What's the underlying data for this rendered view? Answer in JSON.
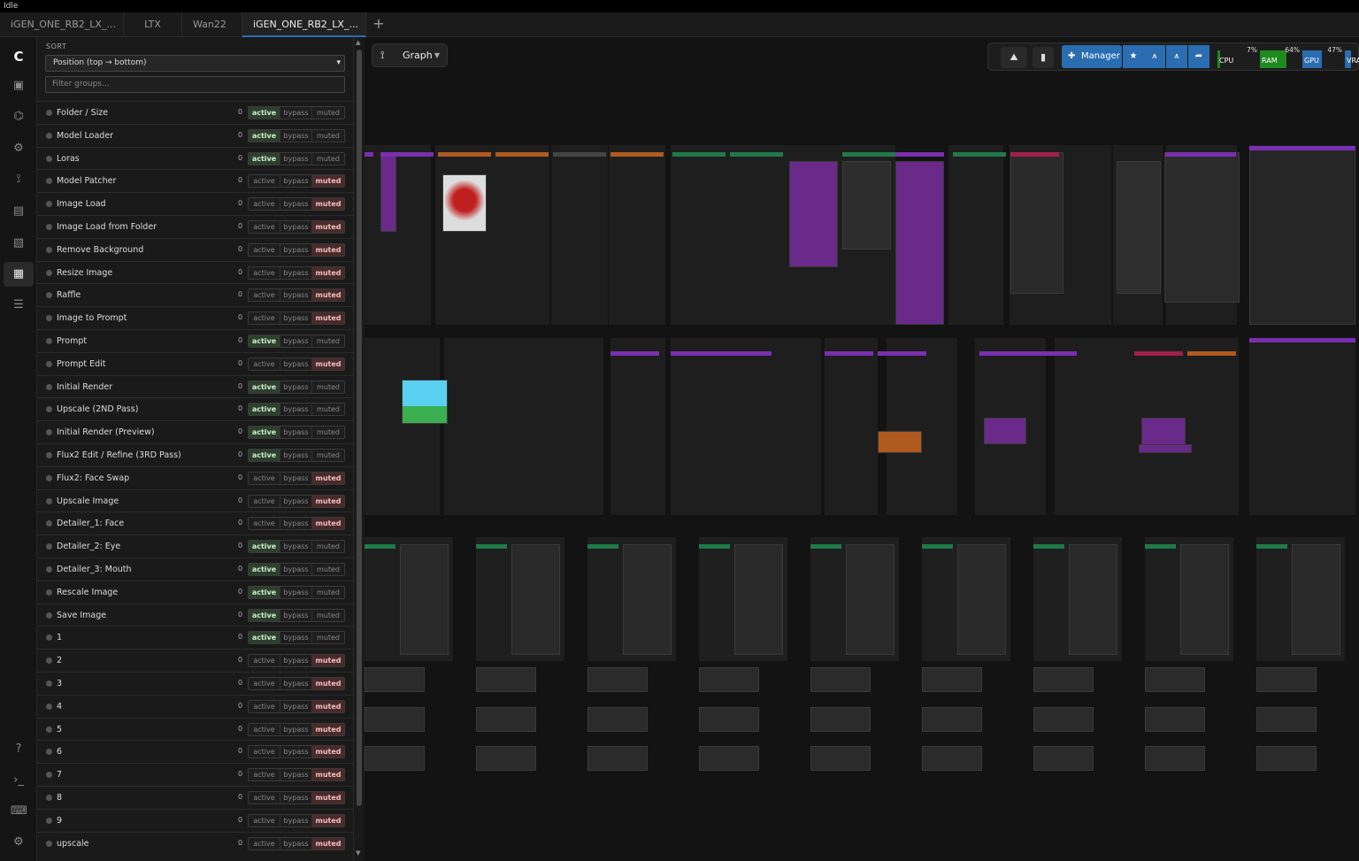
{
  "status": "Idle",
  "tabs": [
    {
      "label": "iGEN_ONE_RB2_LX_...",
      "active": false
    },
    {
      "label": "LTX",
      "active": false
    },
    {
      "label": "Wan22",
      "active": false
    },
    {
      "label": "iGEN_ONE_RB2_LX_...",
      "active": true,
      "unsaved": true
    }
  ],
  "tab_add_icon": "plus-icon",
  "sidebar_icons": [
    "logo-icon",
    "queue-icon",
    "model-library-icon",
    "nodes-library-icon",
    "workflows-icon",
    "templates-icon",
    "media-assets-icon",
    "group-manager-icon",
    "layers-icon",
    "help-icon",
    "terminal-icon",
    "keyboard-icon",
    "settings-icon"
  ],
  "panel": {
    "sort_label": "SORT",
    "sort_value": "Position (top → bottom)",
    "filter_placeholder": "Filter groups...",
    "state_labels": {
      "active": "active",
      "bypass": "bypass",
      "muted": "muted"
    },
    "groups": [
      {
        "name": "Folder / Size",
        "count": "0",
        "state": "active"
      },
      {
        "name": "Model Loader",
        "count": "0",
        "state": "active"
      },
      {
        "name": "Loras",
        "count": "0",
        "state": "active"
      },
      {
        "name": "Model Patcher",
        "count": "0",
        "state": "muted"
      },
      {
        "name": "Image Load",
        "count": "0",
        "state": "muted"
      },
      {
        "name": "Image Load from Folder",
        "count": "0",
        "state": "muted"
      },
      {
        "name": "Remove Background",
        "count": "0",
        "state": "muted"
      },
      {
        "name": "Resize Image",
        "count": "0",
        "state": "muted"
      },
      {
        "name": "Raffle",
        "count": "0",
        "state": "muted"
      },
      {
        "name": "Image to Prompt",
        "count": "0",
        "state": "muted"
      },
      {
        "name": "Prompt",
        "count": "0",
        "state": "active"
      },
      {
        "name": "Prompt Edit",
        "count": "0",
        "state": "muted"
      },
      {
        "name": "Initial Render",
        "count": "0",
        "state": "active"
      },
      {
        "name": "Upscale (2ND Pass)",
        "count": "0",
        "state": "active"
      },
      {
        "name": "Initial Render (Preview)",
        "count": "0",
        "state": "active"
      },
      {
        "name": "Flux2 Edit / Refine (3RD Pass)",
        "count": "0",
        "state": "active"
      },
      {
        "name": "Flux2: Face Swap",
        "count": "0",
        "state": "muted"
      },
      {
        "name": "Upscale Image",
        "count": "0",
        "state": "muted"
      },
      {
        "name": "Detailer_1: Face",
        "count": "0",
        "state": "muted"
      },
      {
        "name": "Detailer_2: Eye",
        "count": "0",
        "state": "active"
      },
      {
        "name": "Detailer_3: Mouth",
        "count": "0",
        "state": "active"
      },
      {
        "name": "Rescale Image",
        "count": "0",
        "state": "active"
      },
      {
        "name": "Save Image",
        "count": "0",
        "state": "active"
      },
      {
        "name": "1",
        "count": "0",
        "state": "active"
      },
      {
        "name": "2",
        "count": "0",
        "state": "muted"
      },
      {
        "name": "3",
        "count": "0",
        "state": "muted"
      },
      {
        "name": "4",
        "count": "0",
        "state": "muted"
      },
      {
        "name": "5",
        "count": "0",
        "state": "muted"
      },
      {
        "name": "6",
        "count": "0",
        "state": "muted"
      },
      {
        "name": "7",
        "count": "0",
        "state": "muted"
      },
      {
        "name": "8",
        "count": "0",
        "state": "muted"
      },
      {
        "name": "9",
        "count": "0",
        "state": "muted"
      },
      {
        "name": "upscale",
        "count": "0",
        "state": "muted"
      }
    ]
  },
  "canvas": {
    "graph_label": "Graph",
    "manager_label": "Manager",
    "meters": [
      {
        "label": "CPU",
        "percent": "7%",
        "value": 0.07,
        "color": "#1f8a1f"
      },
      {
        "label": "RAM",
        "percent": "64%",
        "value": 0.64,
        "color": "#1f8a1f"
      },
      {
        "label": "GPU",
        "percent": "47%",
        "value": 0.47,
        "color": "#2a6db0"
      },
      {
        "label": "VRA",
        "percent": "",
        "value": 0.5,
        "color": "#2a6db0"
      }
    ]
  }
}
